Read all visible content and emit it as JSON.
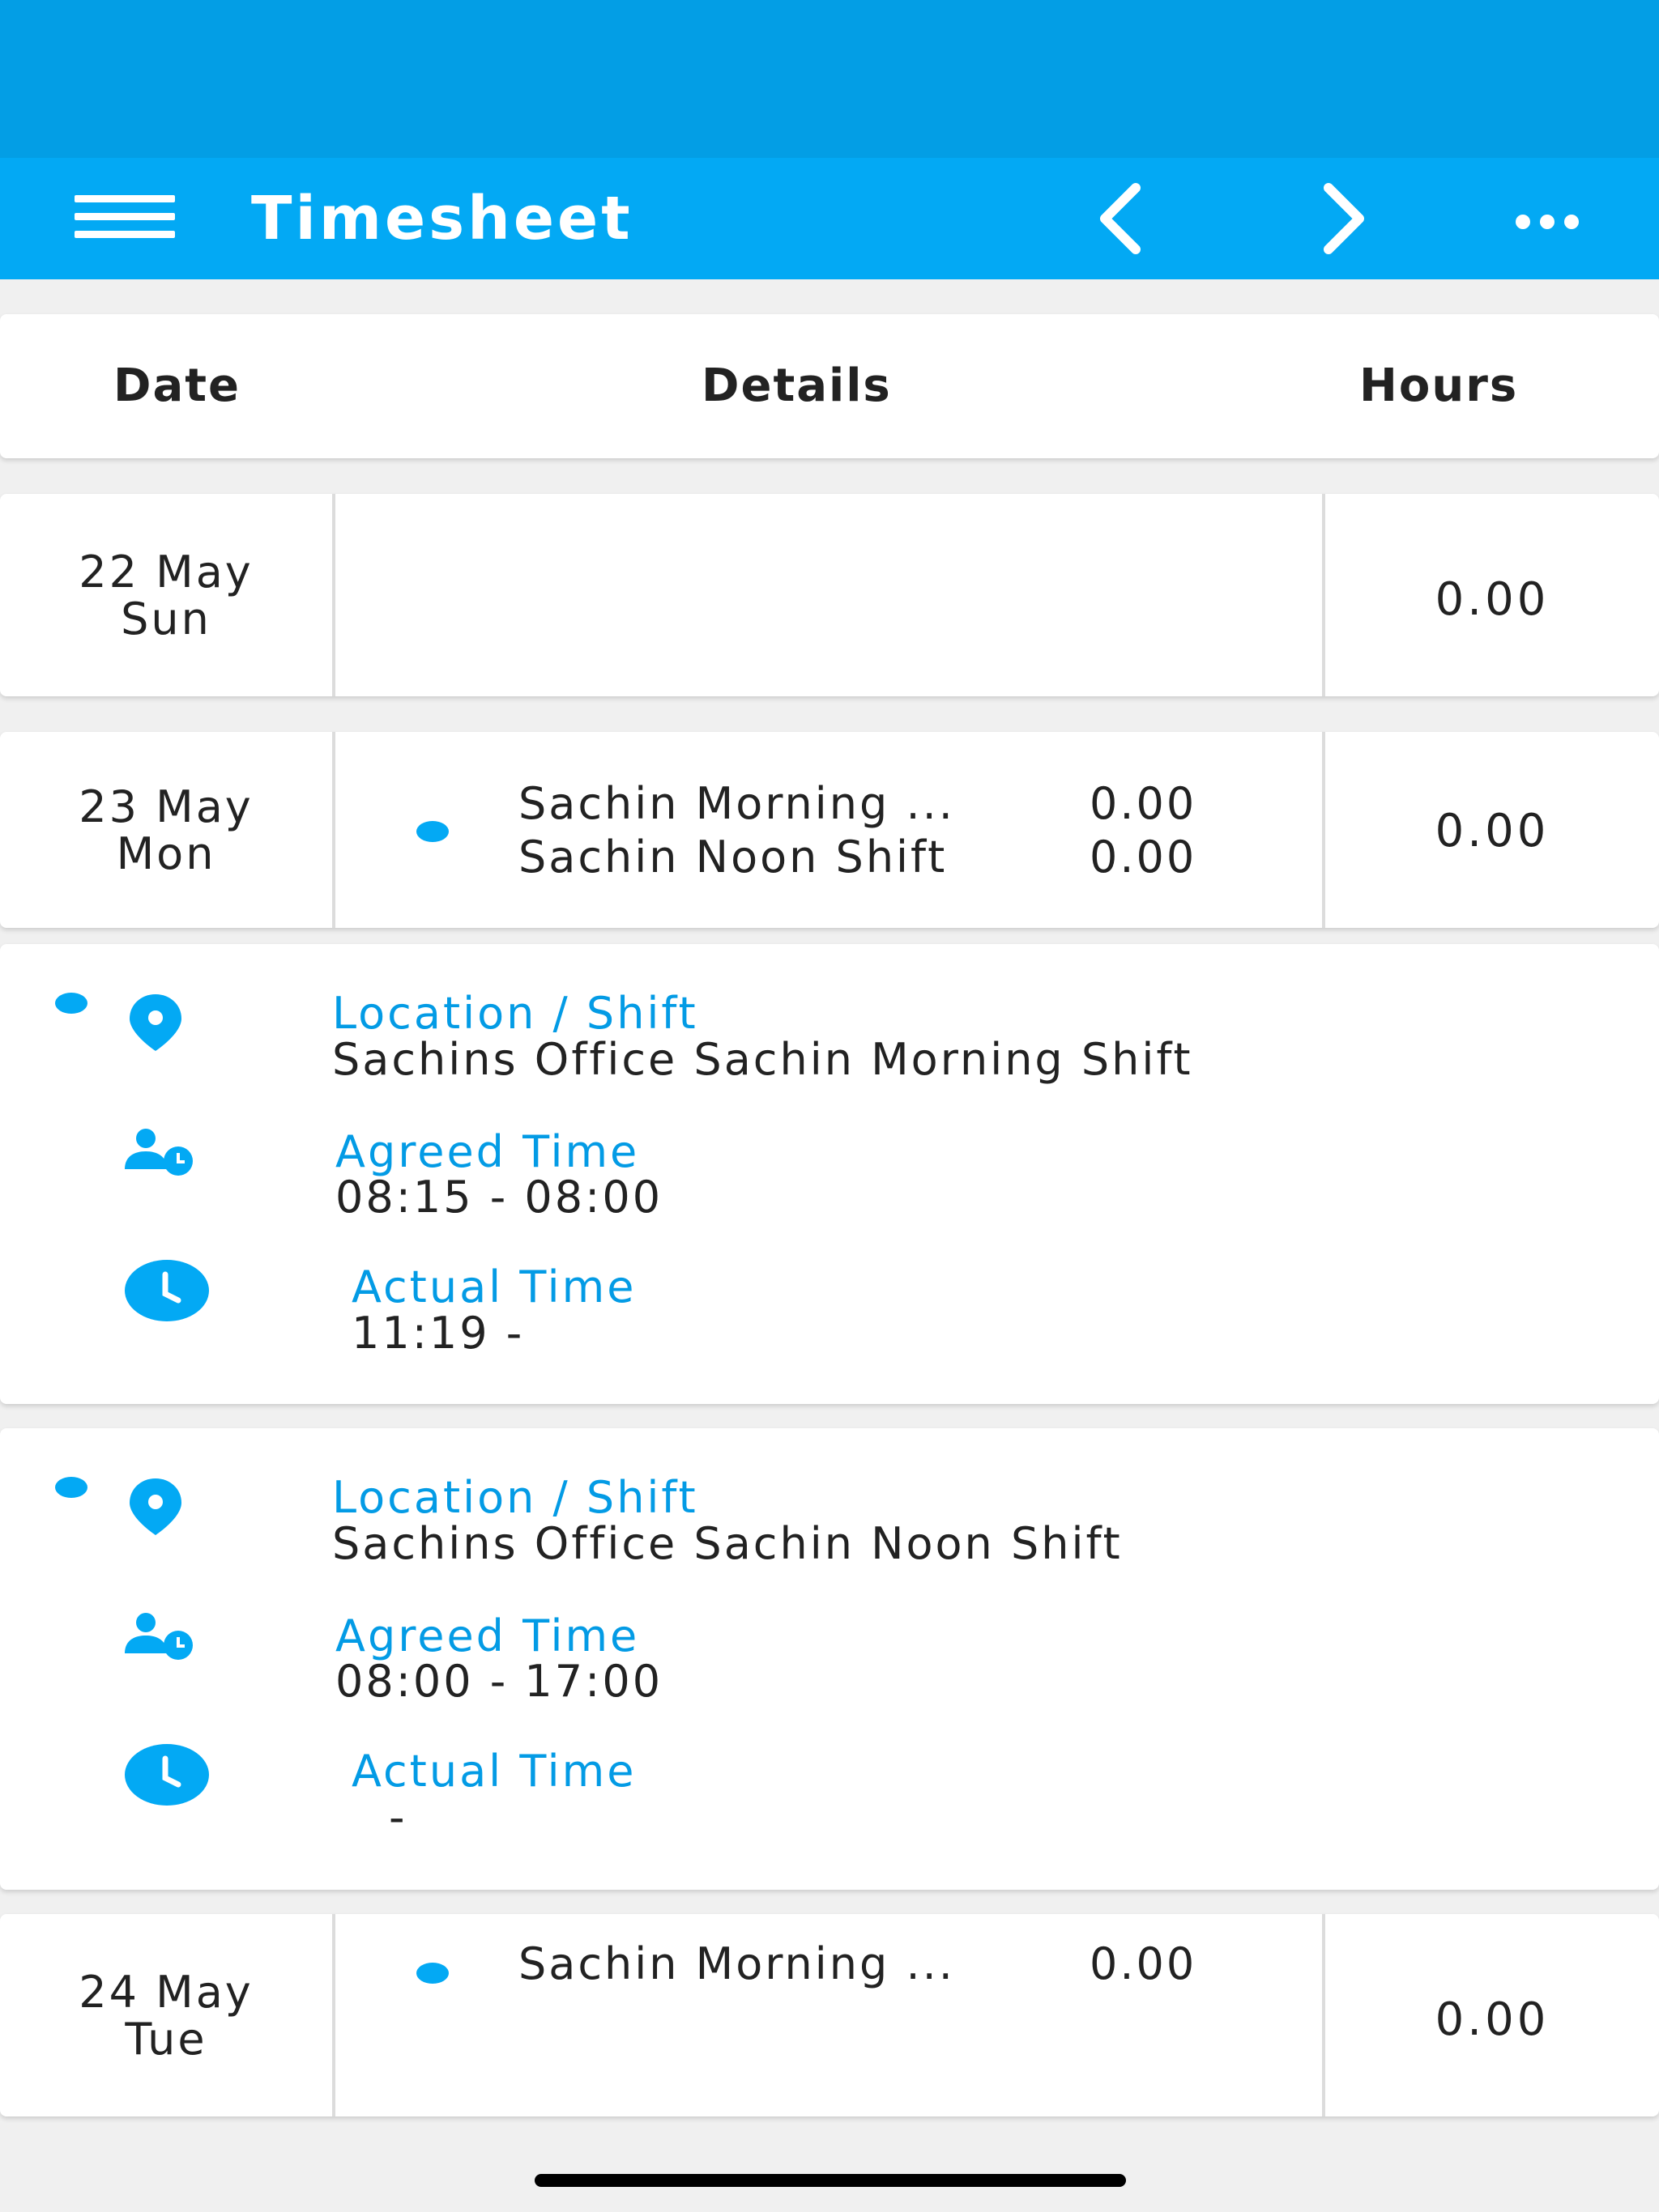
{
  "app_bar": {
    "title": "Timesheet",
    "icons": [
      "menu-icon",
      "chevron-left-icon",
      "chevron-right-icon",
      "more-horizontal-icon"
    ]
  },
  "columns": {
    "date": "Date",
    "details": "Details",
    "hours": "Hours"
  },
  "days": [
    {
      "date": "22 May",
      "weekday": "Sun",
      "hours": "0.00",
      "shifts": []
    },
    {
      "date": "23 May",
      "weekday": "Mon",
      "hours": "0.00",
      "shifts": [
        {
          "name": "Sachin Morning ...",
          "hours": "0.00"
        },
        {
          "name": "Sachin Noon Shift",
          "hours": "0.00"
        }
      ]
    },
    {
      "date": "24 May",
      "weekday": "Tue",
      "hours": "0.00",
      "shifts": [
        {
          "name": "Sachin Morning ...",
          "hours": "0.00"
        }
      ]
    }
  ],
  "shift_details": [
    {
      "location_label": "Location / Shift",
      "location_value": "Sachins Office Sachin Morning Shift",
      "agreed_label": "Agreed Time",
      "agreed_value": "08:15 - 08:00",
      "actual_label": "Actual Time",
      "actual_value": "11:19 -"
    },
    {
      "location_label": "Location / Shift",
      "location_value": "Sachins Office Sachin Noon Shift",
      "agreed_label": "Agreed Time",
      "agreed_value": "08:00 - 17:00",
      "actual_label": "Actual Time",
      "actual_value": "-"
    }
  ],
  "colors": {
    "status_bar": "#039ee5",
    "app_bar": "#03a9f4",
    "accent": "#039be5",
    "background": "#f0f0f0"
  }
}
